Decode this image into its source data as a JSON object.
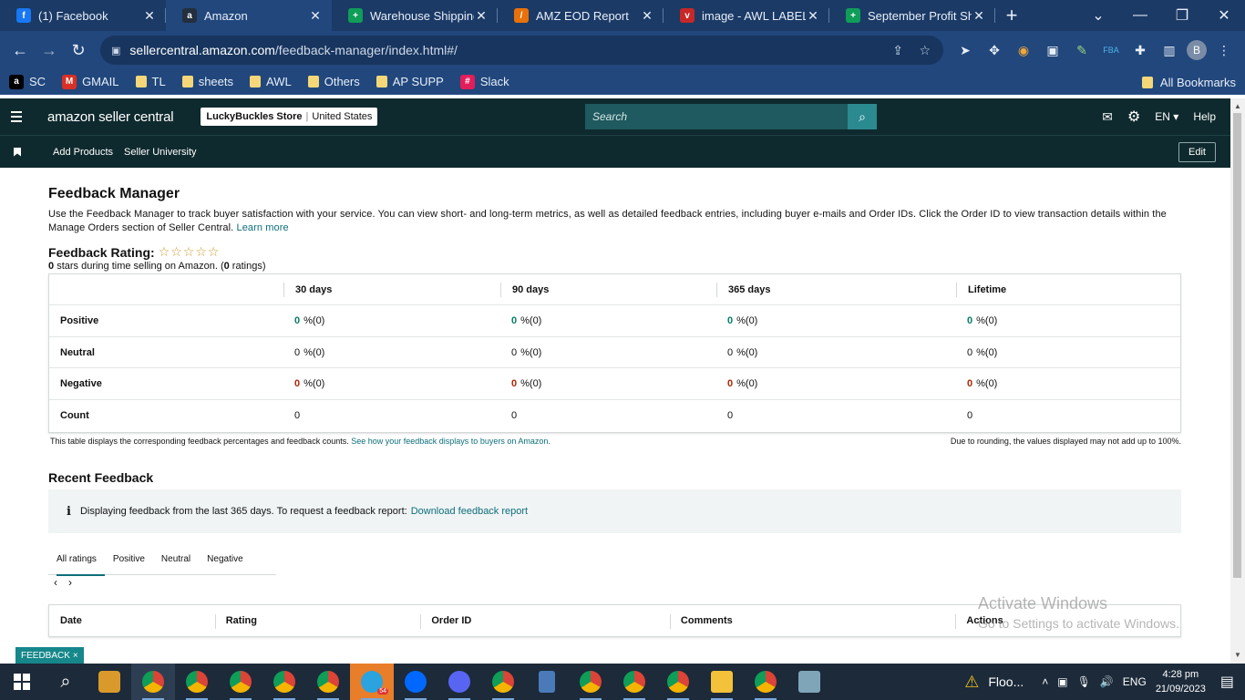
{
  "browser": {
    "tabs": [
      {
        "title": "(1) Facebook",
        "icon": "facebook-icon",
        "color": "#1877f2",
        "glyph": "f",
        "active": false
      },
      {
        "title": "Amazon",
        "icon": "amazon-icon",
        "color": "#232f3e",
        "glyph": "a",
        "active": true
      },
      {
        "title": "Warehouse Shipping &",
        "icon": "sheets-icon",
        "color": "#0f9d58",
        "glyph": "+",
        "active": false
      },
      {
        "title": "AMZ EOD Report",
        "icon": "report-icon",
        "color": "#e8710a",
        "glyph": "/",
        "active": false
      },
      {
        "title": "image - AWL LABEL",
        "icon": "label-icon",
        "color": "#c62828",
        "glyph": "v",
        "active": false
      },
      {
        "title": "September Profit Shee",
        "icon": "sheets-icon",
        "color": "#0f9d58",
        "glyph": "+",
        "active": false
      }
    ],
    "url_host": "sellercentral.amazon.com",
    "url_path": "/feedback-manager/index.html#/",
    "profile_initial": "B",
    "bookmarks": [
      {
        "label": "SC",
        "icon": "amazon-icon"
      },
      {
        "label": "GMAIL",
        "icon": "gmail-icon"
      },
      {
        "label": "TL",
        "icon": "folder-icon"
      },
      {
        "label": "sheets",
        "icon": "folder-icon"
      },
      {
        "label": "AWL",
        "icon": "folder-icon"
      },
      {
        "label": "Others",
        "icon": "folder-icon"
      },
      {
        "label": "AP SUPP",
        "icon": "folder-icon"
      },
      {
        "label": "Slack",
        "icon": "slack-icon"
      }
    ],
    "all_bookmarks": "All Bookmarks"
  },
  "header": {
    "brand": "amazon seller central",
    "store_name": "LuckyBuckles Store",
    "store_region": "United States",
    "search_placeholder": "Search",
    "language": "EN",
    "help": "Help"
  },
  "subnav": {
    "links": [
      "Add Products",
      "Seller University"
    ],
    "edit": "Edit"
  },
  "page": {
    "title": "Feedback Manager",
    "intro": "Use the Feedback Manager to track buyer satisfaction with your service. You can view short- and long-term metrics, as well as detailed feedback entries, including buyer e-mails and Order IDs. Click the Order ID to view transaction details within the Manage Orders section of Seller Central.",
    "learn_more": "Learn more",
    "rating_label": "Feedback Rating:",
    "rating_stars": "☆☆☆☆☆",
    "rating_stars_count": "0",
    "rating_sub_text": "stars during time selling on Amazon. (",
    "rating_count": "0",
    "rating_sub_end": "ratings)"
  },
  "feedback_table": {
    "columns": [
      "30 days",
      "90 days",
      "365 days",
      "Lifetime"
    ],
    "rows": [
      {
        "label": "Positive",
        "values": [
          "0",
          "0",
          "0",
          "0"
        ],
        "suffix": "%(0)"
      },
      {
        "label": "Neutral",
        "values": [
          "0",
          "0",
          "0",
          "0"
        ],
        "suffix": "%(0)"
      },
      {
        "label": "Negative",
        "values": [
          "0",
          "0",
          "0",
          "0"
        ],
        "suffix": "%(0)"
      },
      {
        "label": "Count",
        "values": [
          "0",
          "0",
          "0",
          "0"
        ],
        "suffix": ""
      }
    ],
    "note": "This table displays the corresponding feedback percentages and feedback counts.",
    "note_link": "See how your feedback displays to buyers on Amazon.",
    "note_right": "Due to rounding, the values displayed may not add up to 100%."
  },
  "recent": {
    "title": "Recent Feedback",
    "info": "Displaying feedback from the last 365 days. To request a feedback report:",
    "info_link": "Download feedback report",
    "tabs": [
      "All ratings",
      "Positive",
      "Neutral",
      "Negative"
    ],
    "columns": [
      "Date",
      "Rating",
      "Order ID",
      "Comments",
      "Actions"
    ]
  },
  "overlay": {
    "watermark_1": "Activate Windows",
    "watermark_2": "Go to Settings to activate Windows.",
    "feedback_pill": "FEEDBACK"
  },
  "taskbar": {
    "weather": "Floo...",
    "lang": "ENG",
    "time": "4:28 pm",
    "date": "21/09/2023",
    "telegram_badge": "54"
  }
}
